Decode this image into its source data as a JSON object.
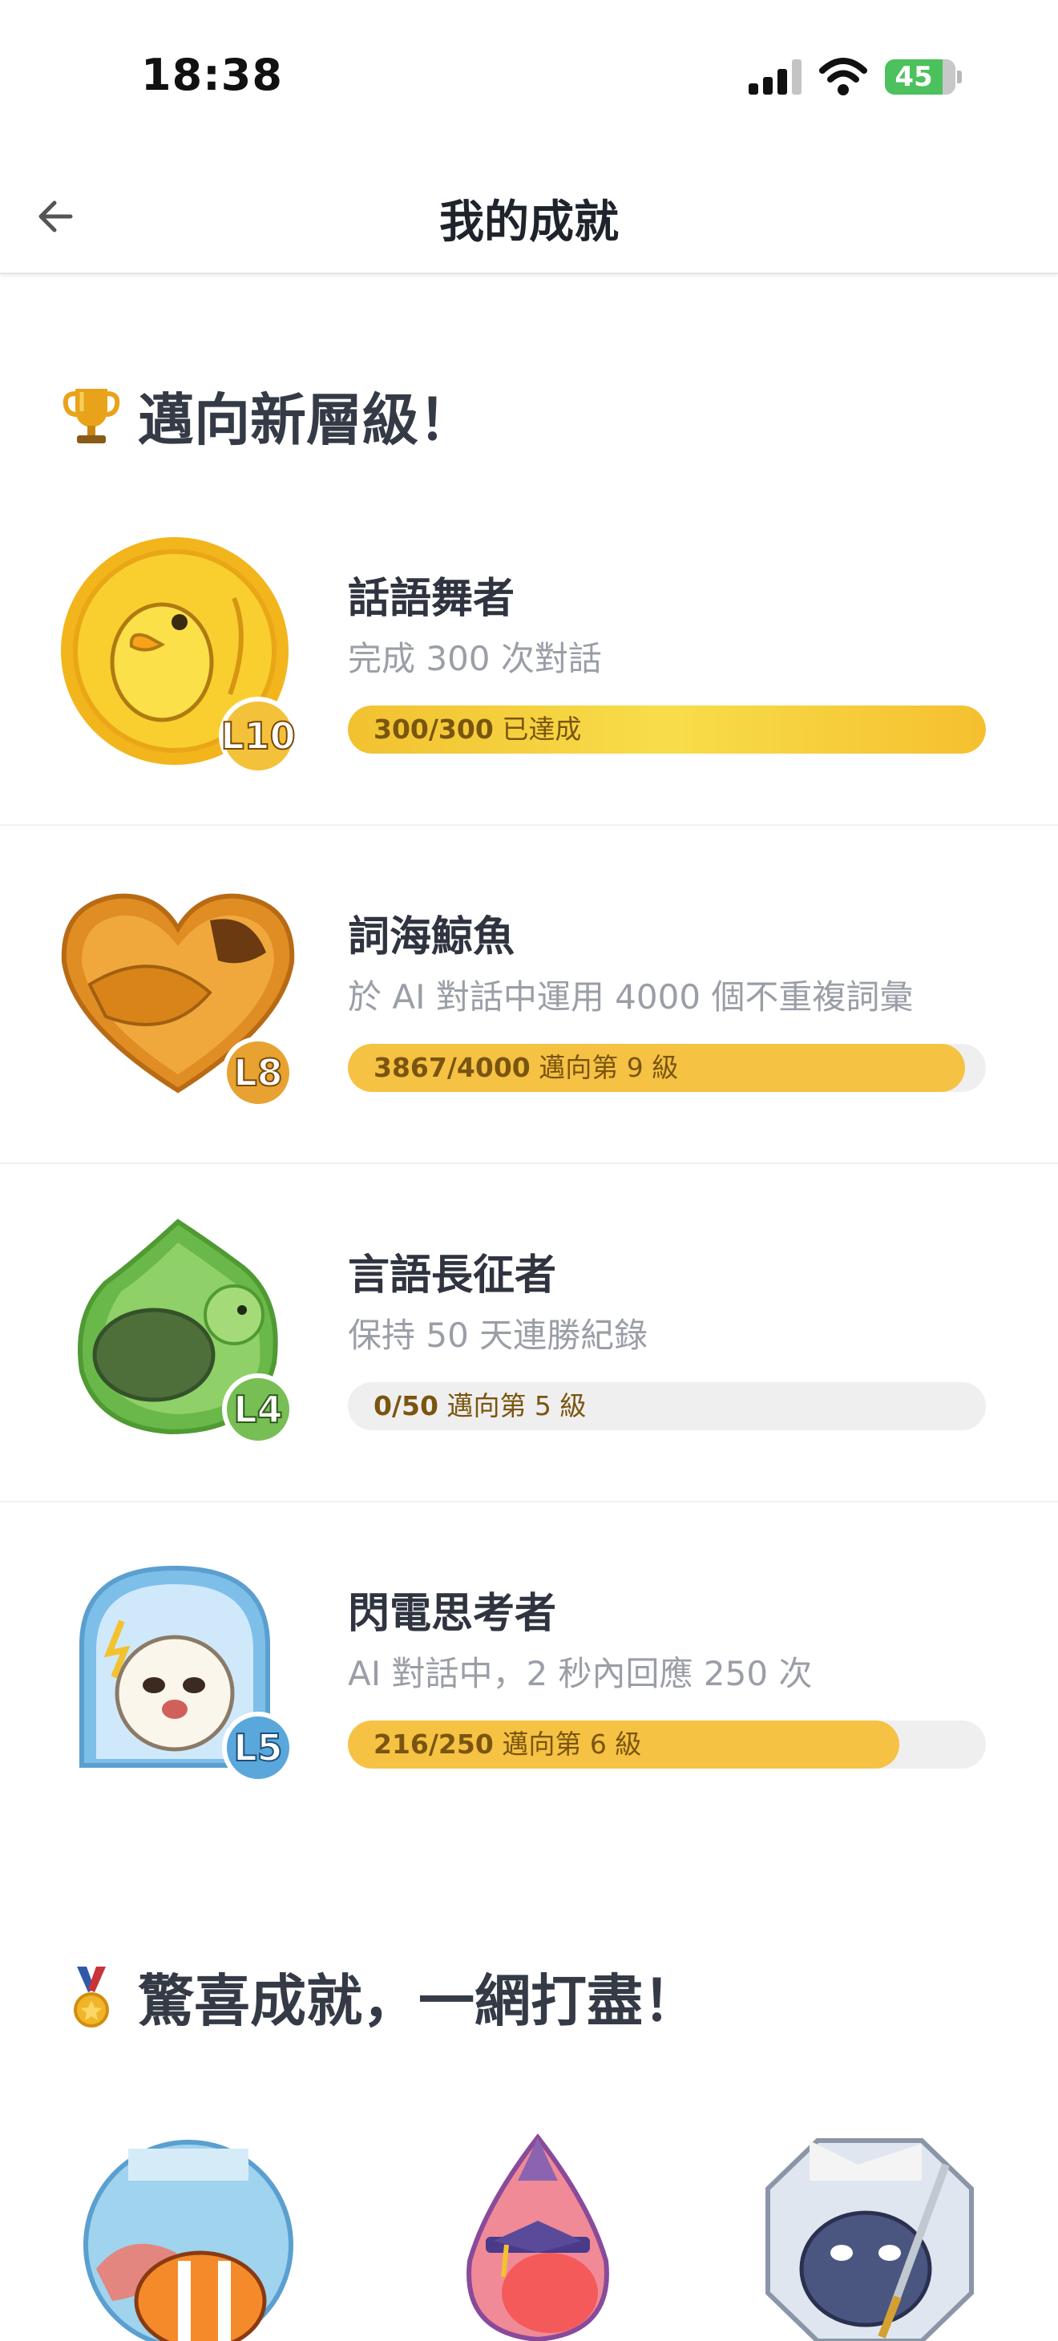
{
  "status_bar": {
    "time": "18:38",
    "battery": "45"
  },
  "header": {
    "title": "我的成就"
  },
  "level_section": {
    "title": "邁向新層級！",
    "emoji": "trophy-icon"
  },
  "achievements": [
    {
      "name": "話語舞者",
      "desc": "完成 300 次對話",
      "progress": "300/300",
      "status": "已達成",
      "level": "L10",
      "fraction": 1.0,
      "color": "#f5c33b"
    },
    {
      "name": "詞海鯨魚",
      "desc": "於 AI 對話中運用 4000 個不重複詞彙",
      "progress": "3867/4000",
      "status": "邁向第 9 級",
      "level": "L8",
      "fraction": 0.9668,
      "color": "#e39a2c"
    },
    {
      "name": "言語長征者",
      "desc": "保持 50 天連勝紀錄",
      "progress": "0/50",
      "status": "邁向第 5 級",
      "level": "L4",
      "fraction": 0,
      "color": "#79c257"
    },
    {
      "name": "閃電思考者",
      "desc": "AI 對話中，2 秒內回應 250 次",
      "progress": "216/250",
      "status": "邁向第 6 級",
      "level": "L5",
      "fraction": 0.864,
      "color": "#7dbfe8"
    }
  ],
  "surprise_section": {
    "title": "驚喜成就，一網打盡！",
    "emoji": "medal-icon"
  }
}
